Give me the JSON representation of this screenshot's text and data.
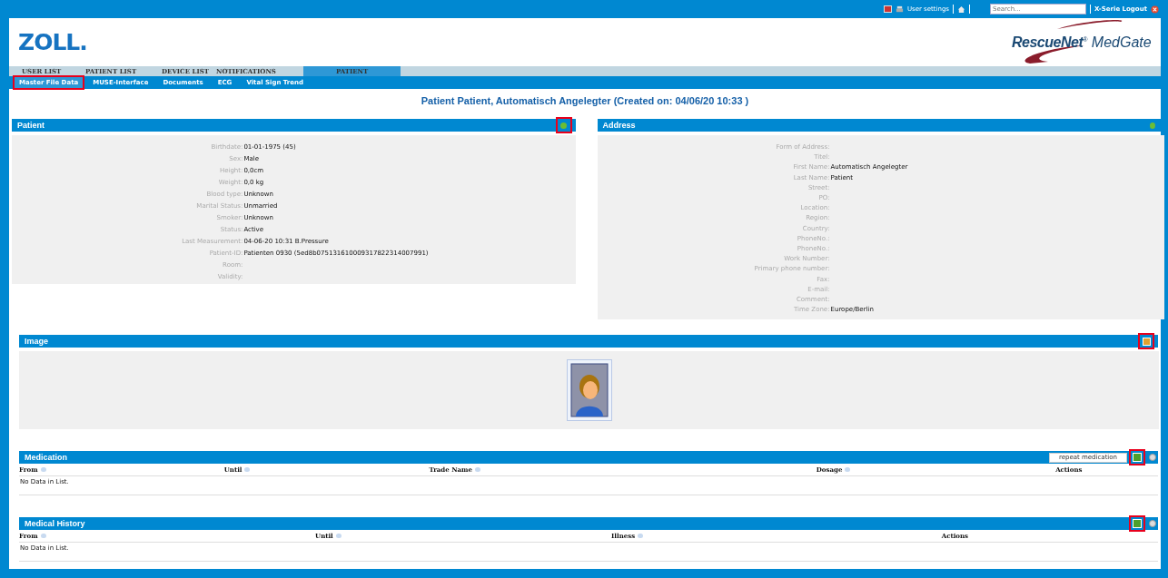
{
  "top_bar": {
    "user_settings": "User settings",
    "search": {
      "placeholder": "Search..."
    },
    "logout": "X-Serie Logout"
  },
  "logos": {
    "left": "ZOLL.",
    "right_bold": "RescueNet",
    "right_mark": "®",
    "right_light": "MedGate"
  },
  "nav_tabs": [
    {
      "label": "USER LIST",
      "selected": false
    },
    {
      "label": "PATIENT LIST",
      "selected": false
    },
    {
      "label": "DEVICE LIST",
      "selected": false
    },
    {
      "label": "NOTIFICATIONS",
      "selected": false
    },
    {
      "label": "PATIENT",
      "selected": true
    }
  ],
  "sub_tabs": [
    {
      "label": "Master File Data",
      "selected": true,
      "highlighted": true
    },
    {
      "label": "MUSE-Interface",
      "selected": false,
      "highlighted": false
    },
    {
      "label": "Documents",
      "selected": false,
      "highlighted": false
    },
    {
      "label": "ECG",
      "selected": false,
      "highlighted": false
    },
    {
      "label": "Vital Sign Trend",
      "selected": false,
      "highlighted": false
    }
  ],
  "page_title": "Patient Patient, Automatisch Angelegter (Created on: 04/06/20 10:33 )",
  "patient": {
    "title": "Patient",
    "edit_highlighted": true,
    "fields": [
      {
        "label": "Birthdate:",
        "value": "01-01-1975 (45)"
      },
      {
        "label": "Sex:",
        "value": "Male"
      },
      {
        "label": "Height:",
        "value": "0,0cm"
      },
      {
        "label": "Weight:",
        "value": "0,0 kg"
      },
      {
        "label": "Blood type:",
        "value": "Unknown"
      },
      {
        "label": "Marital Status:",
        "value": "Unmarried"
      },
      {
        "label": "Smoker:",
        "value": "Unknown"
      },
      {
        "label": "Status:",
        "value": "Active"
      },
      {
        "label": "Last Measurement:",
        "value": "04-06-20 10:31 B.Pressure"
      },
      {
        "label": "Patient-ID:",
        "value": "Patienten 0930 (5ed8b075131610009317822314007991)"
      },
      {
        "label": "Room:"
      },
      {
        "label": "Validity:"
      }
    ]
  },
  "address": {
    "title": "Address",
    "edit_highlighted": false,
    "fields": [
      {
        "label": "Form of Address:"
      },
      {
        "label": "Titel:"
      },
      {
        "label": "First Name:",
        "value": "Automatisch Angelegter"
      },
      {
        "label": "Last Name:",
        "value": "Patient"
      },
      {
        "label": "Street:"
      },
      {
        "label": "PO:"
      },
      {
        "label": "Location:"
      },
      {
        "label": "Region:"
      },
      {
        "label": "Country:"
      },
      {
        "label": "PhoneNo.:"
      },
      {
        "label": "PhoneNo.:"
      },
      {
        "label": "Work Number:"
      },
      {
        "label": "Primary phone number:"
      },
      {
        "label": "Fax:"
      },
      {
        "label": "E-mail:"
      },
      {
        "label": "Comment:"
      },
      {
        "label": "Time Zone:",
        "value": "Europe/Berlin"
      }
    ]
  },
  "image": {
    "title": "Image",
    "upload_highlighted": true
  },
  "medication": {
    "title": "Medication",
    "filter_value": "repeat medication",
    "add_highlighted": true,
    "columns": [
      "From",
      "Until",
      "Trade Name",
      "Dosage",
      "Actions"
    ],
    "empty": "No Data in List."
  },
  "medical_history": {
    "title": "Medical History",
    "add_highlighted": true,
    "columns": [
      "From",
      "Until",
      "Illness",
      "Actions"
    ],
    "empty": "No Data in List."
  }
}
